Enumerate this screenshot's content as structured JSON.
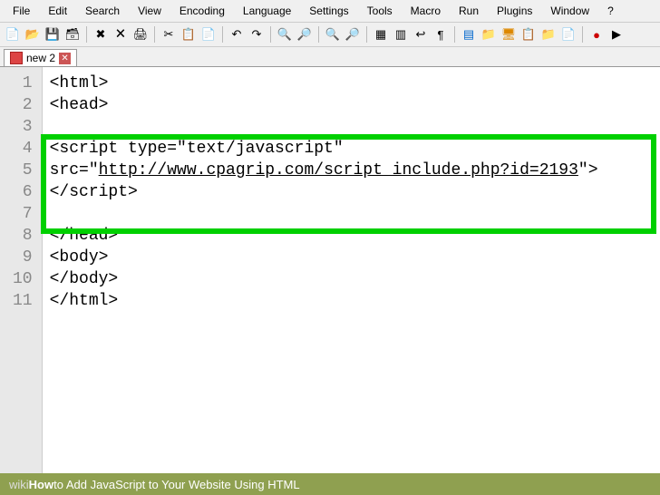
{
  "menu": {
    "items": [
      "File",
      "Edit",
      "Search",
      "View",
      "Encoding",
      "Language",
      "Settings",
      "Tools",
      "Macro",
      "Run",
      "Plugins",
      "Window",
      "?"
    ]
  },
  "tab": {
    "name": "new 2",
    "close": "✕"
  },
  "gutter": {
    "lines": [
      "1",
      "2",
      "3",
      "4",
      "5",
      "6",
      "7",
      "8",
      "9",
      "10",
      "11"
    ]
  },
  "code": {
    "lines": [
      "<html>",
      "<head>",
      "",
      "<script type=\"text/javascript\"",
      "src=\"http://www.cpagrip.com/script_include.php?id=2193\">",
      "</script>",
      "",
      "</head>",
      "<body>",
      "</body>",
      "</html>"
    ],
    "url": "http://www.cpagrip.com/script_include.php?id=2193"
  },
  "footer": {
    "wiki": "wiki",
    "how": "How",
    "title": " to Add JavaScript to Your Website Using HTML"
  }
}
